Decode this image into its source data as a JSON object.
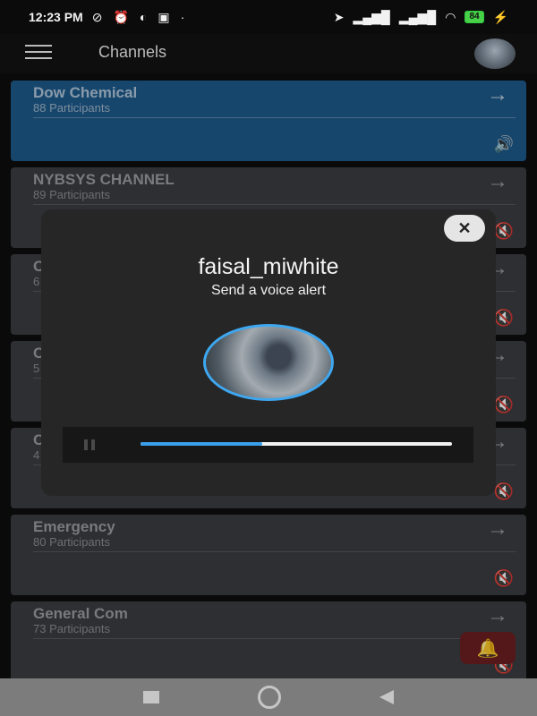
{
  "status_bar": {
    "time": "12:23 PM",
    "battery": "84"
  },
  "app_bar": {
    "title": "Channels"
  },
  "channels": [
    {
      "name": "Dow Chemical",
      "participants": "88 Participants",
      "active": true,
      "volume": "on"
    },
    {
      "name": "NYBSYS CHANNEL",
      "participants": "89 Participants",
      "active": false,
      "volume": "muted"
    },
    {
      "name": "C",
      "participants": "6",
      "active": false,
      "volume": "muted"
    },
    {
      "name": "C",
      "participants": "5",
      "active": false,
      "volume": "muted"
    },
    {
      "name": "C",
      "participants": "4",
      "active": false,
      "volume": "muted"
    },
    {
      "name": "Emergency",
      "participants": "80 Participants",
      "active": false,
      "volume": "muted"
    },
    {
      "name": "General Com",
      "participants": "73 Participants",
      "active": false,
      "volume": "muted"
    }
  ],
  "dialog": {
    "username": "faisal_miwhite",
    "subtitle": "Send a voice alert",
    "close_label": "✕",
    "progress": 0.39
  },
  "icons": {
    "arrow": "→",
    "volume_on": "🔊",
    "volume_muted": "🔇"
  },
  "colors": {
    "accent": "#3aa0ec",
    "active_card": "#1e5a8c",
    "fab": "#6d1f22"
  }
}
